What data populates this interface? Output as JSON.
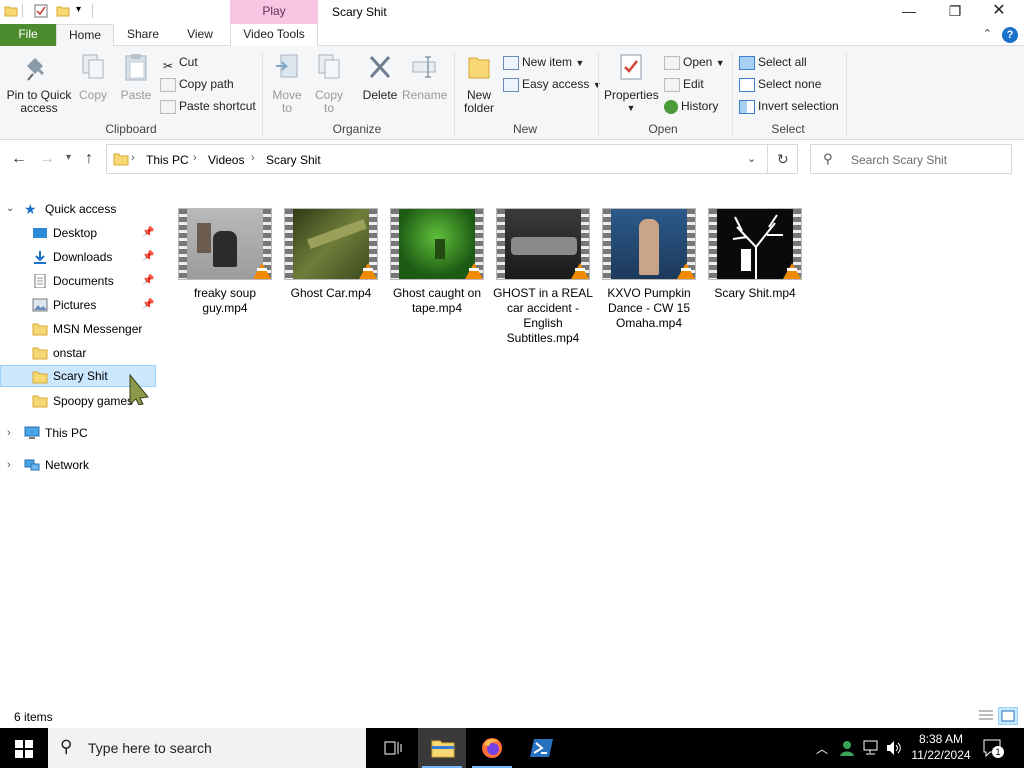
{
  "window": {
    "title": "Scary Shit",
    "context_tab_group": "Play"
  },
  "tabs": {
    "file": "File",
    "home": "Home",
    "share": "Share",
    "view": "View",
    "video_tools": "Video Tools"
  },
  "ribbon": {
    "clipboard": {
      "label": "Clipboard",
      "pin_to_quick_access": "Pin to Quick access",
      "copy": "Copy",
      "paste": "Paste",
      "cut": "Cut",
      "copy_path": "Copy path",
      "paste_shortcut": "Paste shortcut"
    },
    "organize": {
      "label": "Organize",
      "move_to": "Move to",
      "copy_to": "Copy to",
      "delete": "Delete",
      "rename": "Rename"
    },
    "new": {
      "label": "New",
      "new_folder": "New folder",
      "new_item": "New item",
      "easy_access": "Easy access"
    },
    "open": {
      "label": "Open",
      "properties": "Properties",
      "open": "Open",
      "edit": "Edit",
      "history": "History"
    },
    "select": {
      "label": "Select",
      "select_all": "Select all",
      "select_none": "Select none",
      "invert_selection": "Invert selection"
    }
  },
  "address": {
    "crumbs": [
      "This PC",
      "Videos",
      "Scary Shit"
    ],
    "search_placeholder": "Search Scary Shit"
  },
  "navpane": {
    "quick_access": "Quick access",
    "items": [
      "Desktop",
      "Downloads",
      "Documents",
      "Pictures",
      "MSN Messenger",
      "onstar",
      "Scary Shit",
      "Spoopy games"
    ],
    "this_pc": "This PC",
    "network": "Network"
  },
  "files": [
    {
      "name": "freaky soup guy.mp4"
    },
    {
      "name": "Ghost Car.mp4"
    },
    {
      "name": "Ghost caught on tape.mp4"
    },
    {
      "name": "GHOST in a REAL car accident - English Subtitles.mp4"
    },
    {
      "name": "KXVO Pumpkin Dance - CW 15 Omaha.mp4"
    },
    {
      "name": "Scary Shit.mp4"
    }
  ],
  "status": {
    "item_count": "6 items"
  },
  "taskbar": {
    "search_placeholder": "Type here to search",
    "time": "8:38 AM",
    "date": "11/22/2024",
    "notification_count": "1"
  },
  "colors": {
    "file_tab": "#4d8b2f",
    "play_context": "#f7c6e2",
    "selection": "#cce8ff",
    "accent": "#1b73c9"
  }
}
